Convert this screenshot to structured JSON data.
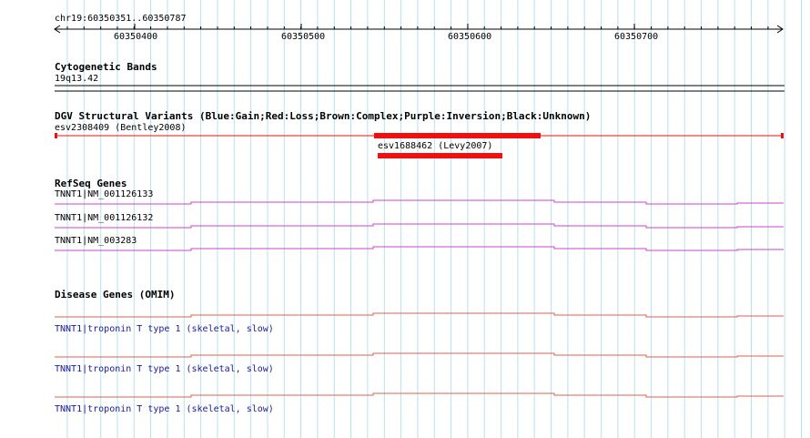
{
  "ruler": {
    "range": "chr19:60350351..60350787",
    "ticks": [
      "60350400",
      "60350500",
      "60350600",
      "60350700"
    ]
  },
  "cytoband": {
    "title": "Cytogenetic Bands",
    "band": "19q13.42"
  },
  "dgv": {
    "title": "DGV Structural Variants (Blue:Gain;Red:Loss;Brown:Complex;Purple:Inversion;Black:Unknown)",
    "variant1": "esv2308409 (Bentley2008)",
    "variant2": "esv1688462 (Levy2007)",
    "color": "#ee1111"
  },
  "refseq": {
    "title": "RefSeq Genes",
    "genes": [
      "TNNT1|NM_001126133",
      "TNNT1|NM_001126132",
      "TNNT1|NM_003283"
    ],
    "color": "#cc44cc"
  },
  "disease": {
    "title": "Disease Genes (OMIM)",
    "genes": [
      "TNNT1|troponin T type 1 (skeletal, slow)",
      "TNNT1|troponin T type 1 (skeletal, slow)",
      "TNNT1|troponin T type 1 (skeletal, slow)"
    ],
    "color": "#e06050"
  }
}
